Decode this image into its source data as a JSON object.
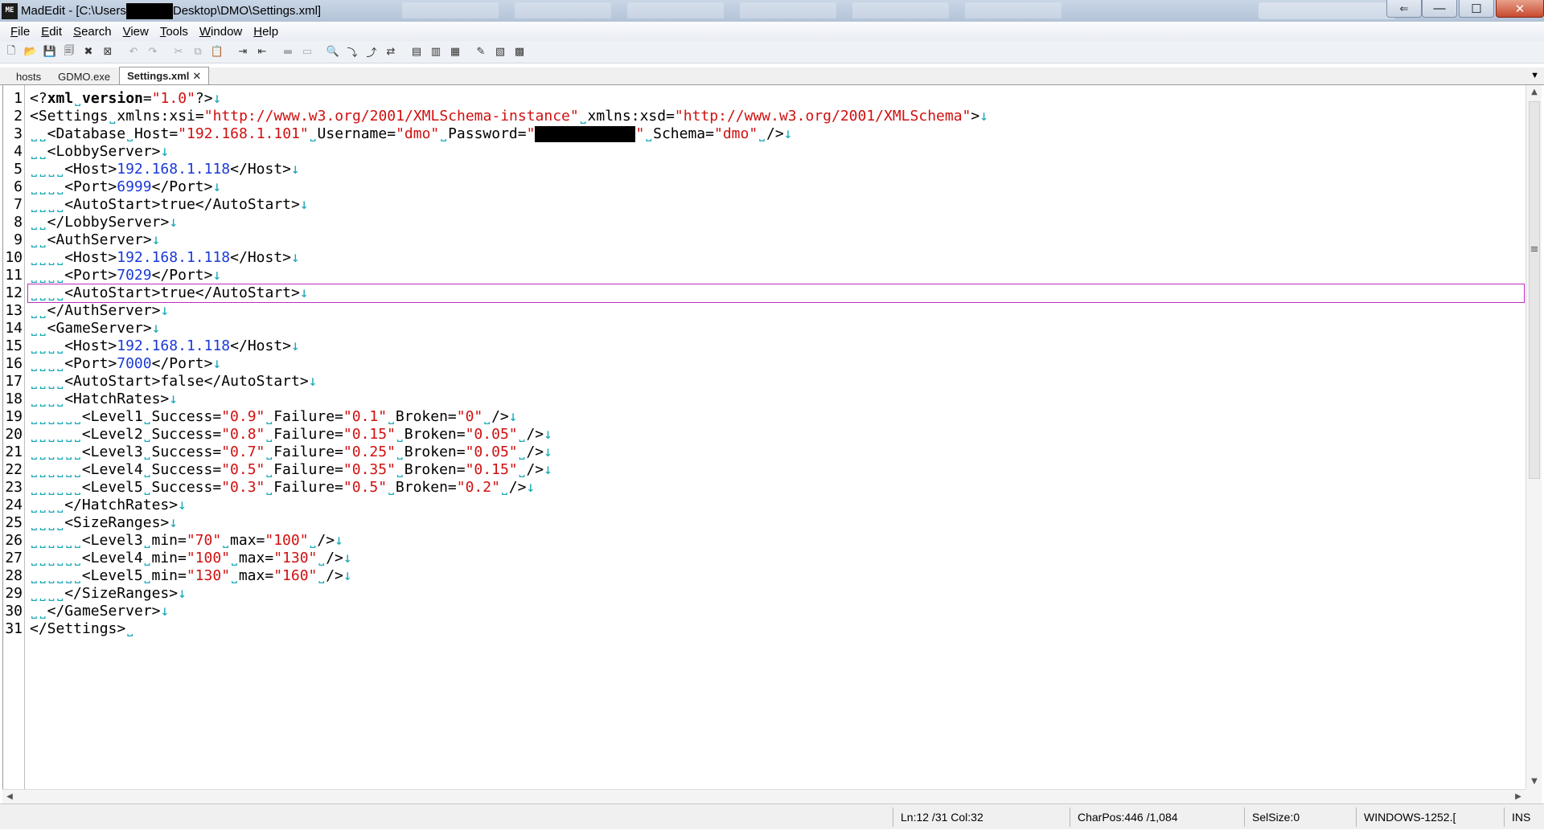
{
  "window": {
    "title_prefix": "MadEdit - [C:\\Users",
    "title_suffix": "Desktop\\DMO\\Settings.xml]",
    "controls": {
      "minimize": "—",
      "maximize": "☐",
      "close": "✕",
      "restore": "⇐"
    }
  },
  "menu": {
    "items": [
      {
        "label": "File",
        "accel": "F",
        "rest": "ile"
      },
      {
        "label": "Edit",
        "accel": "E",
        "rest": "dit"
      },
      {
        "label": "Search",
        "accel": "S",
        "rest": "earch"
      },
      {
        "label": "View",
        "accel": "V",
        "rest": "iew"
      },
      {
        "label": "Tools",
        "accel": "T",
        "rest": "ools"
      },
      {
        "label": "Window",
        "accel": "W",
        "rest": "indow"
      },
      {
        "label": "Help",
        "accel": "H",
        "rest": "elp"
      }
    ]
  },
  "toolbar": {
    "buttons": [
      {
        "name": "new-file-icon",
        "glyph": "🗋",
        "dim": false
      },
      {
        "name": "open-file-icon",
        "glyph": "📂",
        "dim": false
      },
      {
        "name": "save-icon",
        "glyph": "💾",
        "dim": false
      },
      {
        "name": "save-all-icon",
        "glyph": "🗐",
        "dim": false
      },
      {
        "name": "close-file-icon",
        "glyph": "✖",
        "dim": false
      },
      {
        "name": "close-all-icon",
        "glyph": "⊠",
        "dim": false
      },
      {
        "name": "undo-icon",
        "glyph": "↶",
        "dim": true
      },
      {
        "name": "redo-icon",
        "glyph": "↷",
        "dim": true
      },
      {
        "name": "cut-icon",
        "glyph": "✂",
        "dim": true
      },
      {
        "name": "copy-icon",
        "glyph": "⧉",
        "dim": true
      },
      {
        "name": "paste-icon",
        "glyph": "📋",
        "dim": true
      },
      {
        "name": "indent-icon",
        "glyph": "⇥",
        "dim": false
      },
      {
        "name": "unindent-icon",
        "glyph": "⇤",
        "dim": false
      },
      {
        "name": "comment-icon",
        "glyph": "▬",
        "dim": true
      },
      {
        "name": "uncomment-icon",
        "glyph": "▭",
        "dim": true
      },
      {
        "name": "find-icon",
        "glyph": "🔍",
        "dim": false
      },
      {
        "name": "find-next-icon",
        "glyph": "⤵",
        "dim": false
      },
      {
        "name": "find-previous-icon",
        "glyph": "⤴",
        "dim": false
      },
      {
        "name": "replace-icon",
        "glyph": "⇄",
        "dim": false
      },
      {
        "name": "wrap-none-icon",
        "glyph": "▤",
        "dim": false
      },
      {
        "name": "wrap-window-icon",
        "glyph": "▥",
        "dim": false
      },
      {
        "name": "wrap-column-icon",
        "glyph": "▦",
        "dim": false
      },
      {
        "name": "text-mode-icon",
        "glyph": "✎",
        "dim": false
      },
      {
        "name": "column-mode-icon",
        "glyph": "▧",
        "dim": false
      },
      {
        "name": "hex-mode-icon",
        "glyph": "▩",
        "dim": false
      }
    ]
  },
  "tabs": [
    {
      "label": "hosts",
      "active": false
    },
    {
      "label": "GDMO.exe",
      "active": false
    },
    {
      "label": "Settings.xml",
      "active": true,
      "close": "✕"
    }
  ],
  "tab_menu_icon": "▼",
  "editor": {
    "current_line": 12,
    "lines": [
      [
        [
          "kw-tag",
          "<?"
        ],
        [
          "kw",
          "xml"
        ],
        [
          "ws",
          "˽"
        ],
        [
          "kw",
          "version"
        ],
        [
          "tag",
          "="
        ],
        [
          "val",
          "\"1.0\""
        ],
        [
          "tag",
          "?>"
        ],
        [
          "eol",
          "↓"
        ]
      ],
      [
        [
          "tag",
          "<Settings"
        ],
        [
          "ws",
          "˽"
        ],
        [
          "tag",
          "xmlns:xsi="
        ],
        [
          "val",
          "\"http://www.w3.org/2001/XMLSchema-instance\""
        ],
        [
          "ws",
          "˽"
        ],
        [
          "tag",
          "xmlns:xsd="
        ],
        [
          "val",
          "\"http://www.w3.org/2001/XMLSchema\""
        ],
        [
          "tag",
          ">"
        ],
        [
          "eol",
          "↓"
        ]
      ],
      [
        [
          "ws",
          "˽˽"
        ],
        [
          "tag",
          "<Database"
        ],
        [
          "ws",
          "˽"
        ],
        [
          "tag",
          "Host="
        ],
        [
          "val",
          "\"192.168.1.101\""
        ],
        [
          "ws",
          "˽"
        ],
        [
          "tag",
          "Username="
        ],
        [
          "val",
          "\"dmo\""
        ],
        [
          "ws",
          "˽"
        ],
        [
          "tag",
          "Password="
        ],
        [
          "val",
          "\""
        ],
        [
          "redact",
          "          "
        ],
        [
          "val",
          "\""
        ],
        [
          "ws",
          "˽"
        ],
        [
          "tag",
          "Schema="
        ],
        [
          "val",
          "\"dmo\""
        ],
        [
          "ws",
          "˽"
        ],
        [
          "tag",
          "/>"
        ],
        [
          "eol",
          "↓"
        ]
      ],
      [
        [
          "ws",
          "˽˽"
        ],
        [
          "tag",
          "<LobbyServer>"
        ],
        [
          "eol",
          "↓"
        ]
      ],
      [
        [
          "ws",
          "˽˽˽˽"
        ],
        [
          "tag",
          "<Host>"
        ],
        [
          "txt",
          "192.168.1.118"
        ],
        [
          "tag",
          "</Host>"
        ],
        [
          "eol",
          "↓"
        ]
      ],
      [
        [
          "ws",
          "˽˽˽˽"
        ],
        [
          "tag",
          "<Port>"
        ],
        [
          "txt",
          "6999"
        ],
        [
          "tag",
          "</Port>"
        ],
        [
          "eol",
          "↓"
        ]
      ],
      [
        [
          "ws",
          "˽˽˽˽"
        ],
        [
          "tag",
          "<AutoStart>"
        ],
        [
          "tag",
          "true"
        ],
        [
          "tag",
          "</AutoStart>"
        ],
        [
          "eol",
          "↓"
        ]
      ],
      [
        [
          "ws",
          "˽˽"
        ],
        [
          "tag",
          "</LobbyServer>"
        ],
        [
          "eol",
          "↓"
        ]
      ],
      [
        [
          "ws",
          "˽˽"
        ],
        [
          "tag",
          "<AuthServer>"
        ],
        [
          "eol",
          "↓"
        ]
      ],
      [
        [
          "ws",
          "˽˽˽˽"
        ],
        [
          "tag",
          "<Host>"
        ],
        [
          "txt",
          "192.168.1.118"
        ],
        [
          "tag",
          "</Host>"
        ],
        [
          "eol",
          "↓"
        ]
      ],
      [
        [
          "ws",
          "˽˽˽˽"
        ],
        [
          "tag",
          "<Port>"
        ],
        [
          "txt",
          "7029"
        ],
        [
          "tag",
          "</Port>"
        ],
        [
          "eol",
          "↓"
        ]
      ],
      [
        [
          "ws",
          "˽˽˽˽"
        ],
        [
          "tag",
          "<AutoStart>"
        ],
        [
          "tag",
          "true"
        ],
        [
          "tag",
          "</AutoStart>"
        ],
        [
          "eol",
          "↓"
        ]
      ],
      [
        [
          "ws",
          "˽˽"
        ],
        [
          "tag",
          "</AuthServer>"
        ],
        [
          "eol",
          "↓"
        ]
      ],
      [
        [
          "ws",
          "˽˽"
        ],
        [
          "tag",
          "<GameServer>"
        ],
        [
          "eol",
          "↓"
        ]
      ],
      [
        [
          "ws",
          "˽˽˽˽"
        ],
        [
          "tag",
          "<Host>"
        ],
        [
          "txt",
          "192.168.1.118"
        ],
        [
          "tag",
          "</Host>"
        ],
        [
          "eol",
          "↓"
        ]
      ],
      [
        [
          "ws",
          "˽˽˽˽"
        ],
        [
          "tag",
          "<Port>"
        ],
        [
          "txt",
          "7000"
        ],
        [
          "tag",
          "</Port>"
        ],
        [
          "eol",
          "↓"
        ]
      ],
      [
        [
          "ws",
          "˽˽˽˽"
        ],
        [
          "tag",
          "<AutoStart>"
        ],
        [
          "tag",
          "false"
        ],
        [
          "tag",
          "</AutoStart>"
        ],
        [
          "eol",
          "↓"
        ]
      ],
      [
        [
          "ws",
          "˽˽˽˽"
        ],
        [
          "tag",
          "<HatchRates>"
        ],
        [
          "eol",
          "↓"
        ]
      ],
      [
        [
          "ws",
          "˽˽˽˽˽˽"
        ],
        [
          "tag",
          "<Level1"
        ],
        [
          "ws",
          "˽"
        ],
        [
          "tag",
          "Success="
        ],
        [
          "val",
          "\"0.9\""
        ],
        [
          "ws",
          "˽"
        ],
        [
          "tag",
          "Failure="
        ],
        [
          "val",
          "\"0.1\""
        ],
        [
          "ws",
          "˽"
        ],
        [
          "tag",
          "Broken="
        ],
        [
          "val",
          "\"0\""
        ],
        [
          "ws",
          "˽"
        ],
        [
          "tag",
          "/>"
        ],
        [
          "eol",
          "↓"
        ]
      ],
      [
        [
          "ws",
          "˽˽˽˽˽˽"
        ],
        [
          "tag",
          "<Level2"
        ],
        [
          "ws",
          "˽"
        ],
        [
          "tag",
          "Success="
        ],
        [
          "val",
          "\"0.8\""
        ],
        [
          "ws",
          "˽"
        ],
        [
          "tag",
          "Failure="
        ],
        [
          "val",
          "\"0.15\""
        ],
        [
          "ws",
          "˽"
        ],
        [
          "tag",
          "Broken="
        ],
        [
          "val",
          "\"0.05\""
        ],
        [
          "ws",
          "˽"
        ],
        [
          "tag",
          "/>"
        ],
        [
          "eol",
          "↓"
        ]
      ],
      [
        [
          "ws",
          "˽˽˽˽˽˽"
        ],
        [
          "tag",
          "<Level3"
        ],
        [
          "ws",
          "˽"
        ],
        [
          "tag",
          "Success="
        ],
        [
          "val",
          "\"0.7\""
        ],
        [
          "ws",
          "˽"
        ],
        [
          "tag",
          "Failure="
        ],
        [
          "val",
          "\"0.25\""
        ],
        [
          "ws",
          "˽"
        ],
        [
          "tag",
          "Broken="
        ],
        [
          "val",
          "\"0.05\""
        ],
        [
          "ws",
          "˽"
        ],
        [
          "tag",
          "/>"
        ],
        [
          "eol",
          "↓"
        ]
      ],
      [
        [
          "ws",
          "˽˽˽˽˽˽"
        ],
        [
          "tag",
          "<Level4"
        ],
        [
          "ws",
          "˽"
        ],
        [
          "tag",
          "Success="
        ],
        [
          "val",
          "\"0.5\""
        ],
        [
          "ws",
          "˽"
        ],
        [
          "tag",
          "Failure="
        ],
        [
          "val",
          "\"0.35\""
        ],
        [
          "ws",
          "˽"
        ],
        [
          "tag",
          "Broken="
        ],
        [
          "val",
          "\"0.15\""
        ],
        [
          "ws",
          "˽"
        ],
        [
          "tag",
          "/>"
        ],
        [
          "eol",
          "↓"
        ]
      ],
      [
        [
          "ws",
          "˽˽˽˽˽˽"
        ],
        [
          "tag",
          "<Level5"
        ],
        [
          "ws",
          "˽"
        ],
        [
          "tag",
          "Success="
        ],
        [
          "val",
          "\"0.3\""
        ],
        [
          "ws",
          "˽"
        ],
        [
          "tag",
          "Failure="
        ],
        [
          "val",
          "\"0.5\""
        ],
        [
          "ws",
          "˽"
        ],
        [
          "tag",
          "Broken="
        ],
        [
          "val",
          "\"0.2\""
        ],
        [
          "ws",
          "˽"
        ],
        [
          "tag",
          "/>"
        ],
        [
          "eol",
          "↓"
        ]
      ],
      [
        [
          "ws",
          "˽˽˽˽"
        ],
        [
          "tag",
          "</HatchRates>"
        ],
        [
          "eol",
          "↓"
        ]
      ],
      [
        [
          "ws",
          "˽˽˽˽"
        ],
        [
          "tag",
          "<SizeRanges>"
        ],
        [
          "eol",
          "↓"
        ]
      ],
      [
        [
          "ws",
          "˽˽˽˽˽˽"
        ],
        [
          "tag",
          "<Level3"
        ],
        [
          "ws",
          "˽"
        ],
        [
          "tag",
          "min="
        ],
        [
          "val",
          "\"70\""
        ],
        [
          "ws",
          "˽"
        ],
        [
          "tag",
          "max="
        ],
        [
          "val",
          "\"100\""
        ],
        [
          "ws",
          "˽"
        ],
        [
          "tag",
          "/>"
        ],
        [
          "eol",
          "↓"
        ]
      ],
      [
        [
          "ws",
          "˽˽˽˽˽˽"
        ],
        [
          "tag",
          "<Level4"
        ],
        [
          "ws",
          "˽"
        ],
        [
          "tag",
          "min="
        ],
        [
          "val",
          "\"100\""
        ],
        [
          "ws",
          "˽"
        ],
        [
          "tag",
          "max="
        ],
        [
          "val",
          "\"130\""
        ],
        [
          "ws",
          "˽"
        ],
        [
          "tag",
          "/>"
        ],
        [
          "eol",
          "↓"
        ]
      ],
      [
        [
          "ws",
          "˽˽˽˽˽˽"
        ],
        [
          "tag",
          "<Level5"
        ],
        [
          "ws",
          "˽"
        ],
        [
          "tag",
          "min="
        ],
        [
          "val",
          "\"130\""
        ],
        [
          "ws",
          "˽"
        ],
        [
          "tag",
          "max="
        ],
        [
          "val",
          "\"160\""
        ],
        [
          "ws",
          "˽"
        ],
        [
          "tag",
          "/>"
        ],
        [
          "eol",
          "↓"
        ]
      ],
      [
        [
          "ws",
          "˽˽˽˽"
        ],
        [
          "tag",
          "</SizeRanges>"
        ],
        [
          "eol",
          "↓"
        ]
      ],
      [
        [
          "ws",
          "˽˽"
        ],
        [
          "tag",
          "</GameServer>"
        ],
        [
          "eol",
          "↓"
        ]
      ],
      [
        [
          "tag",
          "</Settings>"
        ],
        [
          "eol",
          "˽"
        ]
      ]
    ]
  },
  "scrollbars": {
    "up": "▲",
    "down": "▼",
    "left": "◀",
    "right": "▶",
    "marker": "≡"
  },
  "status": {
    "position": "Ln:12 /31 Col:32",
    "charpos": "CharPos:446 /1,084",
    "selsize": "SelSize:0",
    "encoding": "WINDOWS-1252.[",
    "mode": "INS"
  },
  "colors": {
    "tag": "#000000",
    "attribute_value": "#d01010",
    "text_value": "#1a3ad8",
    "whitespace_marker": "#18a8b8",
    "current_line_border": "#c02cc0"
  }
}
